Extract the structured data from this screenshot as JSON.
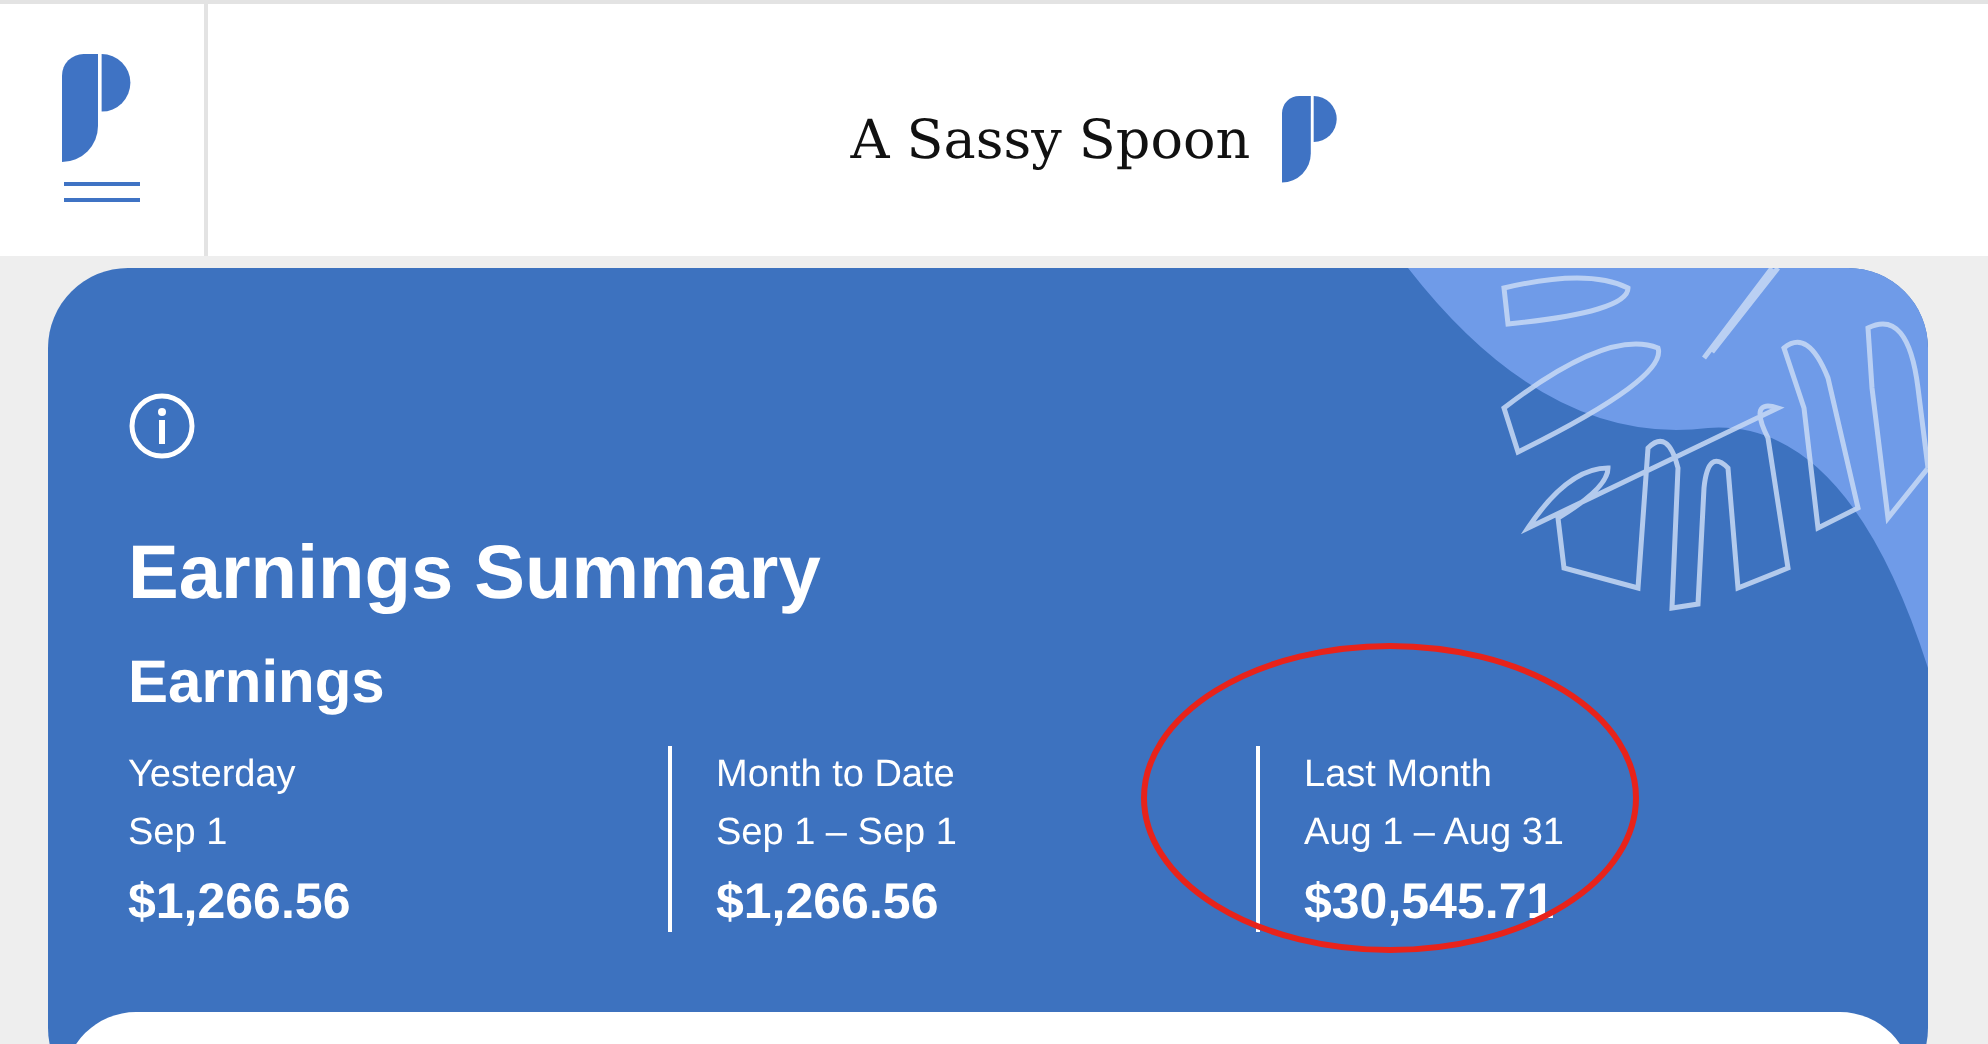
{
  "header": {
    "title": "A Sassy Spoon"
  },
  "card": {
    "title": "Earnings Summary",
    "section": "Earnings",
    "stats": [
      {
        "label": "Yesterday",
        "range": "Sep 1",
        "amount": "$1,266.56",
        "circled": false
      },
      {
        "label": "Month to Date",
        "range": "Sep 1 – Sep 1",
        "amount": "$1,266.56",
        "circled": false
      },
      {
        "label": "Last Month",
        "range": "Aug 1 – Aug 31",
        "amount": "$30,545.71",
        "circled": true
      }
    ]
  }
}
